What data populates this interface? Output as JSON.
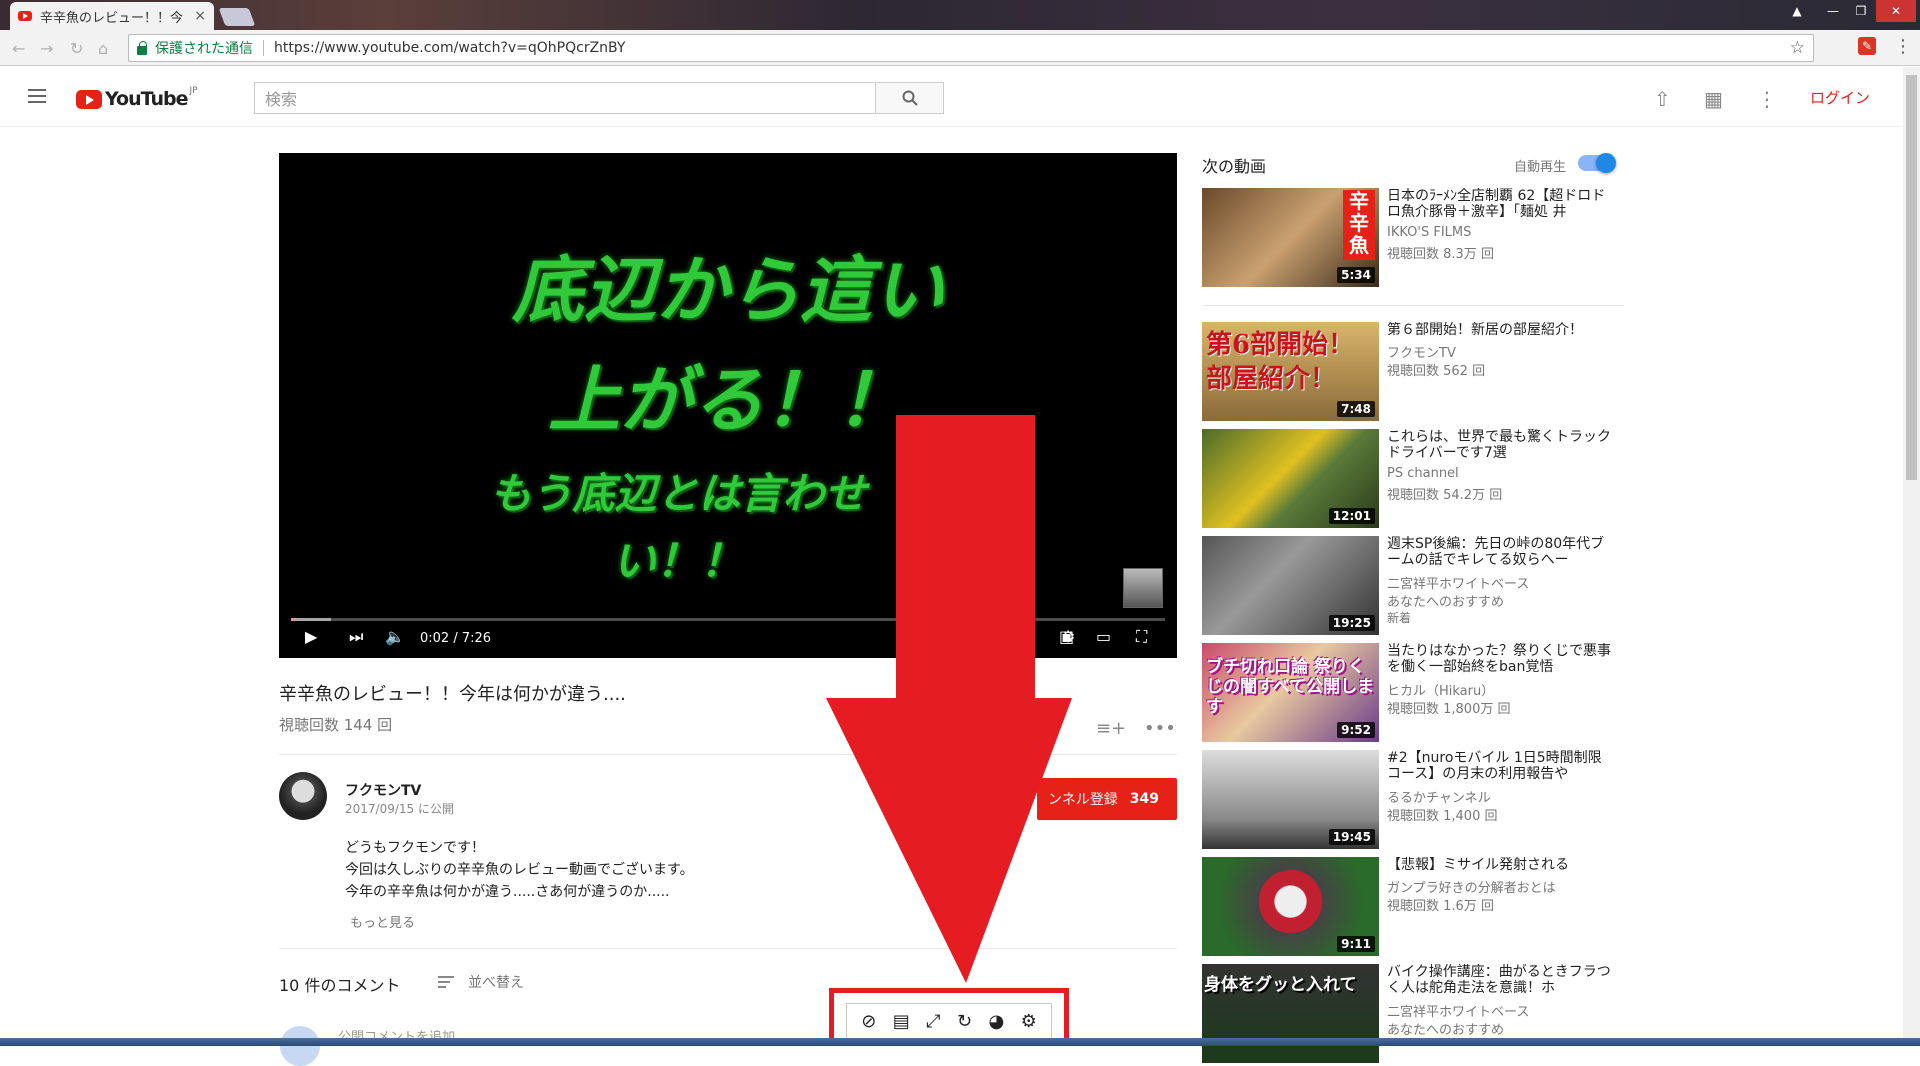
{
  "browser": {
    "tab_title": "辛辛魚のレビュー！！今",
    "tab_close": "×",
    "secure_label": "保護された通信",
    "url": "https://www.youtube.com/watch?v=qOhPQcrZnBY"
  },
  "youtube": {
    "logo_text": "YouTube",
    "logo_region": "JP",
    "search_placeholder": "検索",
    "login_label": "ログイン"
  },
  "player": {
    "overlay_line1": "底辺から這い",
    "overlay_line2": "上がる！！",
    "overlay_line3": "もう底辺とは言わせ",
    "overlay_line4": "い！！",
    "time": "0:02 / 7:26",
    "progress_fraction": 0.0045
  },
  "video": {
    "title": "辛辛魚のレビュー！！今年は何かが違う....",
    "views": "視聴回数 144 回",
    "channel": "フクモンTV",
    "published": "2017/09/15 に公開",
    "subscribe_label": "ンネル登録",
    "subscriber_count": "349",
    "description_lines": [
      "どうもフクモンです！",
      "今回は久しぶりの辛辛魚のレビュー動画でございます。",
      "今年の辛辛魚は何かが違う.....さあ何が違うのか....."
    ],
    "show_more": "もっと見る"
  },
  "comments": {
    "count": "10 件のコメント",
    "sort_label": "並べ替え",
    "add_placeholder": "公開コメントを追加..."
  },
  "sidebar": {
    "up_next": "次の動画",
    "autoplay": "自動再生",
    "items": [
      {
        "title": "日本のﾗｰﾒﾝ全店制覇 62【超ドロドロ魚介豚骨＋激辛】「麺処 井",
        "channel": "IKKO'S FILMS",
        "views": "視聴回数 8.3万 回",
        "badge": "",
        "duration": "5:34",
        "thumb_text": "辛辛魚"
      },
      {
        "title": "第６部開始！新居の部屋紹介！",
        "channel": "フクモンTV",
        "views": "視聴回数 562 回",
        "badge": "",
        "duration": "7:48",
        "thumb_text": "第6部開始！部屋紹介！"
      },
      {
        "title": "これらは、世界で最も驚くトラックドライバーです7選",
        "channel": "PS channel",
        "views": "視聴回数 54.2万 回",
        "badge": "",
        "duration": "12:01",
        "thumb_text": ""
      },
      {
        "title": "週末SP後編：先日の峠の80年代ブームの話でキレてる奴らへー",
        "channel": "二宮祥平ホワイトベース",
        "views": "あなたへのおすすめ",
        "badge": "新着",
        "duration": "19:25",
        "thumb_text": ""
      },
      {
        "title": "当たりはなかった？祭りくじで悪事を働く一部始終をban覚悟",
        "channel": "ヒカル（Hikaru）",
        "views": "視聴回数 1,800万 回",
        "badge": "",
        "duration": "9:52",
        "thumb_text": "ブチ切れ口論 祭りくじの闇すべて公開します"
      },
      {
        "title": "#2【nuroモバイル 1日5時間制限コース】の月末の利用報告や",
        "channel": "るるかチャンネル",
        "views": "視聴回数 1,400 回",
        "badge": "",
        "duration": "19:45",
        "thumb_text": ""
      },
      {
        "title": "【悲報】ミサイル発射される",
        "channel": "ガンプラ好きの分解者おとは",
        "views": "視聴回数 1.6万 回",
        "badge": "",
        "duration": "9:11",
        "thumb_text": ""
      },
      {
        "title": "バイク操作講座：曲がるときフラつく人は舵角走法を意識！ホ",
        "channel": "二宮祥平ホワイトベース",
        "views": "あなたへのおすすめ",
        "badge": "",
        "duration": "",
        "thumb_text": "身体をグッと入れて"
      }
    ]
  },
  "overlay_toolbar": {
    "icons": [
      "block-icon",
      "film-icon",
      "expand-icon",
      "reload-icon",
      "speed-icon",
      "settings-icon"
    ]
  },
  "colors": {
    "accent_red": "#e62117",
    "arrow_red": "#e61c23",
    "secure_green": "#0b8043",
    "overlay_text_green": "#2fc93a"
  }
}
